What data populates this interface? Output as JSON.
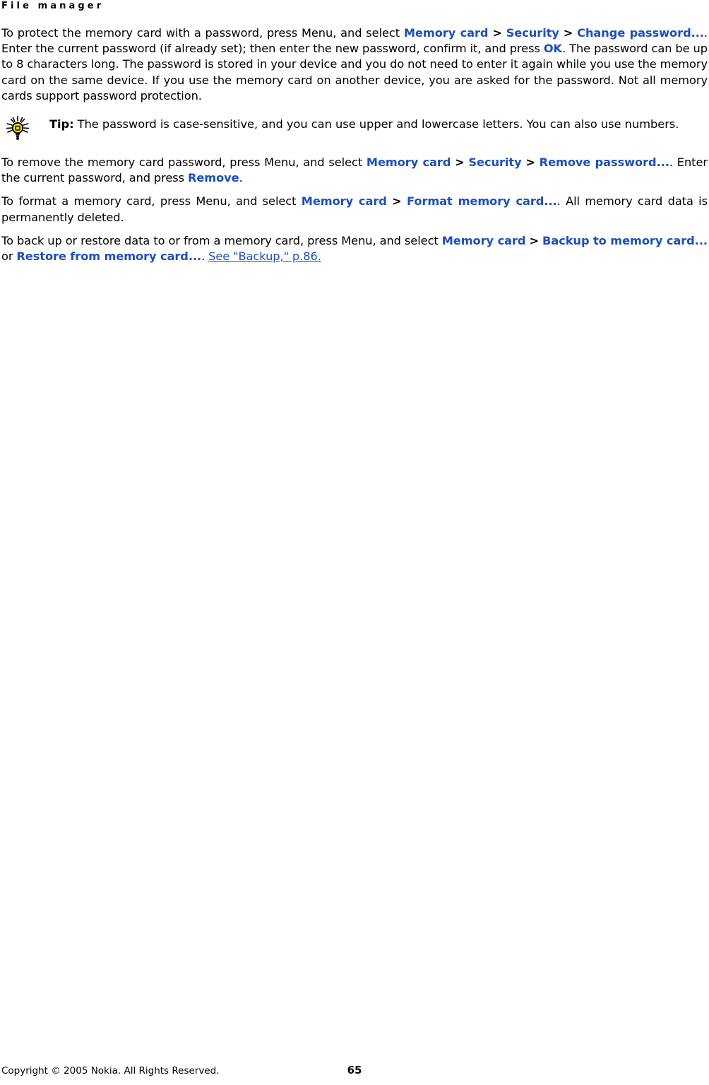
{
  "header": {
    "title": "File manager"
  },
  "paragraphs": {
    "p1": {
      "seg1": "To protect the memory card with a password, press Menu, and select ",
      "ui1": "Memory card",
      "sep1": ">",
      "ui2": "Security",
      "sep2": ">",
      "ui3": "Change password...",
      "seg2": ". Enter the current password (if already set); then enter the new password, confirm it, and press ",
      "ui4": "OK",
      "seg3": ". The password can be up to 8 characters long. The password is stored in your device and you do not need to enter it again while you use the memory card on the same device. If you use the memory card on another device, you are asked for the password. Not all memory cards support password protection."
    },
    "p2": {
      "seg1": "To remove the memory card password, press Menu, and select ",
      "ui1": "Memory card",
      "sep1": ">",
      "ui2": "Security",
      "sep2": ">",
      "ui3": "Remove password...",
      "seg2": ". Enter the current password, and press ",
      "ui4": "Remove",
      "seg3": "."
    },
    "p3": {
      "seg1": "To format a memory card, press Menu, and select ",
      "ui1": "Memory card",
      "sep1": ">",
      "ui2": "Format memory card...",
      "seg2": ". All memory card data is permanently deleted."
    },
    "p4": {
      "seg1": "To back up or restore data to or from a memory card, press Menu, and select ",
      "ui1": "Memory card",
      "sep1": ">",
      "ui2": "Backup to memory card...",
      "seg2": " or ",
      "ui3": "Restore from memory card...",
      "seg3": ". ",
      "link": "See \"Backup,\" p.86."
    }
  },
  "tip": {
    "icon": "lightbulb-icon",
    "label": "Tip:",
    "text": "The password is case-sensitive, and you can use upper and lowercase letters. You can also use numbers."
  },
  "footer": {
    "copyright": "Copyright © 2005 Nokia. All Rights Reserved.",
    "page_number": "65"
  },
  "colors": {
    "link_blue": "#1b4ec4",
    "text_black": "#000000",
    "bulb_yellow": "#f5e000",
    "background": "#ffffff"
  }
}
